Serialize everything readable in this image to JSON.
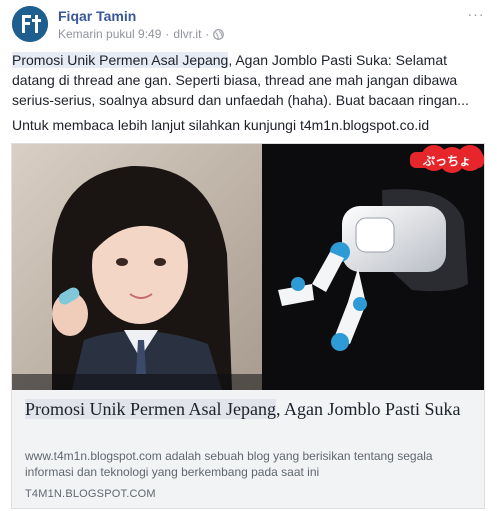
{
  "post": {
    "author": "Fiqar Tamin",
    "timestamp": "Kemarin pukul 9:49",
    "separator": "·",
    "source": "dlvr.it",
    "more_label": "···",
    "message_highlight": "Promosi Unik Permen Asal Jepang",
    "message_rest": ", Agan Jomblo Pasti Suka: Selamat datang di thread ane gan. Seperti biasa, thread ane mah jangan dibawa serius-serius, soalnya absurd dan unfaedah (haha). Buat bacaan ringan...",
    "read_more": "Untuk membaca lebih lanjut silahkan kunjungi t4m1n.blogspot.co.id"
  },
  "card": {
    "image_text": "ぷっちょ",
    "title_highlight": "Promosi Unik Permen Asal Jepang",
    "title_rest": ", Agan Jomblo Pasti Suka",
    "description": "www.t4m1n.blogspot.com adalah sebuah blog yang berisikan tentang segala informasi dan teknologi yang berkembang pada saat ini",
    "domain": "T4M1N.BLOGSPOT.COM"
  },
  "colors": {
    "author_link": "#385898",
    "meta_gray": "#90949c",
    "card_bg": "#f2f3f5",
    "avatar_bg": "#1f5f8f"
  },
  "icons": {
    "avatar": "avatar-logo-icon",
    "privacy": "globe-icon",
    "menu": "more-options-icon"
  }
}
